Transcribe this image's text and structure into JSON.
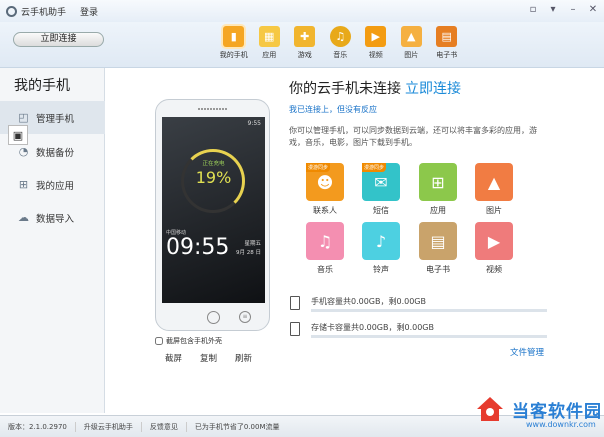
{
  "window": {
    "title": "云手机助手",
    "login": "登录"
  },
  "toolbar": {
    "connect_button": "立即连接",
    "nav": [
      {
        "label": "我的手机",
        "icon": "phone-icon",
        "color": "#f5a623"
      },
      {
        "label": "应用",
        "icon": "apps-icon",
        "color": "#f6c844"
      },
      {
        "label": "游戏",
        "icon": "gamepad-icon",
        "color": "#f1b52e"
      },
      {
        "label": "音乐",
        "icon": "music-icon",
        "color": "#e8a91a"
      },
      {
        "label": "视频",
        "icon": "video-icon",
        "color": "#f39c12"
      },
      {
        "label": "图片",
        "icon": "picture-icon",
        "color": "#f5b041"
      },
      {
        "label": "电子书",
        "icon": "ebook-icon",
        "color": "#e67e22"
      }
    ]
  },
  "sidebar": {
    "title": "我的手机",
    "items": [
      {
        "label": "管理手机",
        "icon": "manage-phone-icon"
      },
      {
        "label": "数据备份",
        "icon": "backup-icon"
      },
      {
        "label": "我的应用",
        "icon": "apps-grid-icon"
      },
      {
        "label": "数据导入",
        "icon": "cloud-import-icon"
      }
    ]
  },
  "phone": {
    "status_time": "9:55",
    "charging_label": "正在充电",
    "charge_percent": "19%",
    "carrier": "中国移动",
    "clock": "09:55",
    "weekday": "星期五",
    "date": "9月 28 日",
    "case_option": "截屏包含手机外壳",
    "actions": [
      "截屏",
      "复制",
      "刷新"
    ]
  },
  "main": {
    "title": "你的云手机未连接",
    "connect_link": "立即连接",
    "sub_link": "我已连接上，但没有反应",
    "description": "你可以管理手机，可以同步数据到云端，还可以将丰富多彩的应用，游戏，音乐，电影，图片下载到手机。",
    "tiles": [
      {
        "label": "联系人",
        "icon": "contacts-icon",
        "color": "#f39a1e",
        "badge": "漫游同步"
      },
      {
        "label": "短信",
        "icon": "sms-icon",
        "color": "#33c3c9",
        "badge": "漫游同步"
      },
      {
        "label": "应用",
        "icon": "apps-icon",
        "color": "#8cc84b",
        "badge": ""
      },
      {
        "label": "图片",
        "icon": "picture-icon",
        "color": "#f17c43",
        "badge": ""
      },
      {
        "label": "音乐",
        "icon": "music-icon",
        "color": "#f48fb1",
        "badge": ""
      },
      {
        "label": "铃声",
        "icon": "bell-icon",
        "color": "#4dd0e1",
        "badge": ""
      },
      {
        "label": "电子书",
        "icon": "ebook-icon",
        "color": "#c9a36b",
        "badge": ""
      },
      {
        "label": "视频",
        "icon": "video-icon",
        "color": "#ef7b7b",
        "badge": ""
      }
    ],
    "phone_storage": "手机容量共0.00GB，剩0.00GB",
    "sd_storage": "存储卡容量共0.00GB，剩0.00GB",
    "file_manage": "文件管理"
  },
  "statusbar": {
    "version": "版本：2.1.0.2970",
    "upgrade": "升级云手机助手",
    "feedback": "反馈意见",
    "traffic": "已为手机节省了0.00M流量"
  },
  "watermark": {
    "title": "当客软件园",
    "url": "www.downkr.com"
  }
}
